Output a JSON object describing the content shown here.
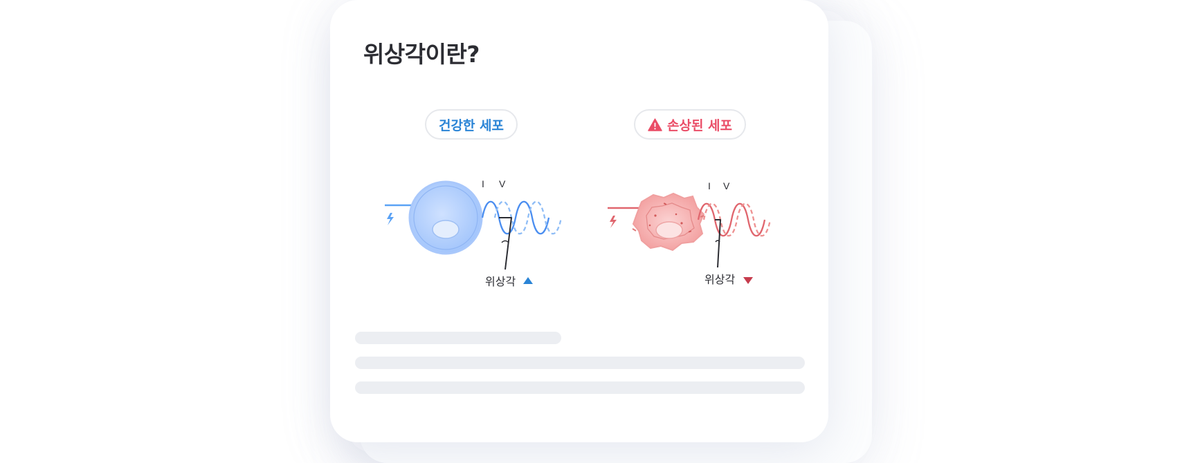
{
  "title": "위상각이란?",
  "badges": {
    "healthy": "건강한 세포",
    "damaged": "손상된 세포"
  },
  "diagram": {
    "healthy": {
      "current_label": "I",
      "voltage_label": "V",
      "angle_label": "위상각",
      "trend": "up",
      "color": "#2a84d6"
    },
    "damaged": {
      "current_label": "I",
      "voltage_label": "V",
      "angle_label": "위상각",
      "trend": "down",
      "color": "#c63c4d"
    }
  },
  "colors": {
    "healthy_accent": "#2a84d6",
    "damaged_accent": "#ea4d67",
    "title_text": "#2c2d33",
    "skeleton": "#eceef2"
  },
  "icons": [
    "warning-icon",
    "lightning-icon",
    "triangle-up-icon",
    "triangle-down-icon"
  ]
}
